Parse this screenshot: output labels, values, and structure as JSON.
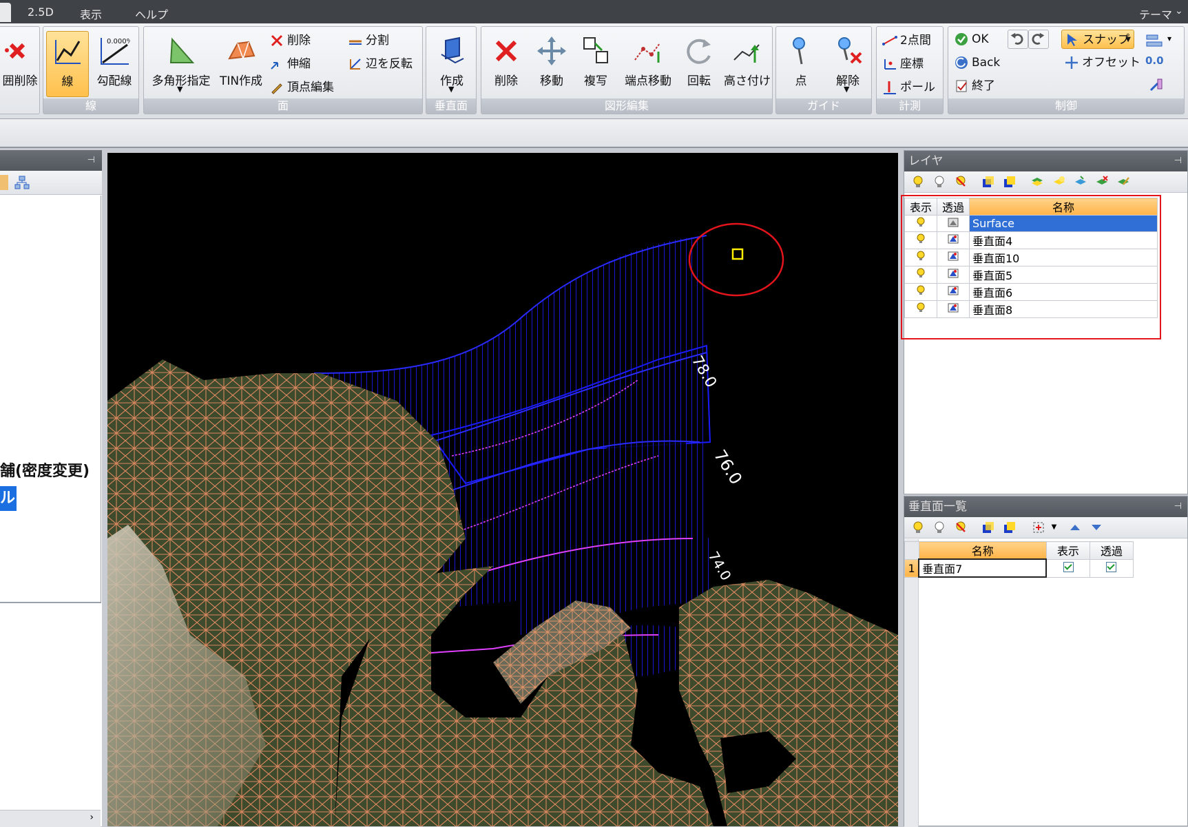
{
  "menu": {
    "items": [
      "2.5D",
      "表示",
      "ヘルプ"
    ],
    "theme": "テーマ"
  },
  "ribbon": {
    "partial_delete_label": "囲削除",
    "line_group": {
      "label": "線",
      "line": "線",
      "slope_line": "勾配線",
      "slope_badge": "0.000%"
    },
    "face_group": {
      "label": "面",
      "polygon": "多角形指定",
      "tin": "TIN作成",
      "delete": "削除",
      "stretch": "伸縮",
      "vertex_edit": "頂点編集",
      "split": "分割",
      "flip_edge": "辺を反転"
    },
    "vplane_group": {
      "label": "垂直面",
      "create": "作成"
    },
    "edit_group": {
      "label": "図形編集",
      "delete": "削除",
      "move": "移動",
      "copy": "複写",
      "endpoint_move": "端点移動",
      "rotate": "回転",
      "height": "高さ付け"
    },
    "guide_group": {
      "label": "ガイド",
      "point": "点",
      "release": "解除"
    },
    "measure_group": {
      "label": "計測",
      "two_point": "2点間",
      "coords": "座標",
      "pole": "ポール"
    },
    "control_group": {
      "label": "制御",
      "ok": "OK",
      "back": "Back",
      "end": "終了",
      "snap": "スナップ",
      "offset": "オフセット",
      "zero": "0.0"
    }
  },
  "left_panel": {
    "text1": "舗(密度変更)",
    "text2": "ル"
  },
  "viewport": {
    "labels": [
      "78.0",
      "76.0",
      "74.0"
    ]
  },
  "layer_panel": {
    "title": "レイヤ",
    "headers": {
      "show": "表示",
      "trans": "透過",
      "name": "名称"
    },
    "rows": [
      "Surface",
      "垂直面4",
      "垂直面10",
      "垂直面5",
      "垂直面6",
      "垂直面8"
    ]
  },
  "list_panel": {
    "title": "垂直面一覧",
    "headers": {
      "name": "名称",
      "show": "表示",
      "trans": "透過"
    },
    "rows": [
      {
        "no": "1",
        "name": "垂直面7"
      }
    ]
  },
  "colors": {
    "accent": "#ffb347",
    "selection": "#2f6fd6",
    "highlight": "#e3141c",
    "mesh": "#d9875f",
    "wall": "#1414ff",
    "profile": "#e040ff"
  }
}
